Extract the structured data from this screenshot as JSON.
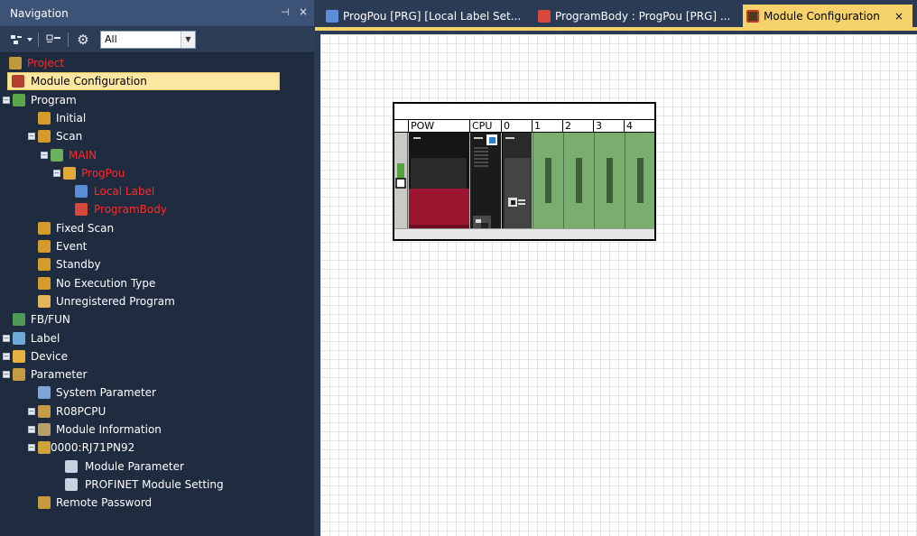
{
  "navigation": {
    "title": "Navigation",
    "pin_glyph": "⊣",
    "close_glyph": "×",
    "toolbar": {
      "filter_value": "All"
    },
    "tree": [
      {
        "label": "Project",
        "red": true
      },
      {
        "label": "Module Configuration",
        "selected": true
      },
      {
        "label": "Program"
      },
      {
        "label": "Initial"
      },
      {
        "label": "Scan"
      },
      {
        "label": "MAIN",
        "red": true
      },
      {
        "label": "ProgPou",
        "red": true
      },
      {
        "label": "Local Label",
        "red": true
      },
      {
        "label": "ProgramBody",
        "red": true
      },
      {
        "label": "Fixed Scan"
      },
      {
        "label": "Event"
      },
      {
        "label": "Standby"
      },
      {
        "label": "No Execution Type"
      },
      {
        "label": "Unregistered Program"
      },
      {
        "label": "FB/FUN"
      },
      {
        "label": "Label"
      },
      {
        "label": "Device"
      },
      {
        "label": "Parameter"
      },
      {
        "label": "System Parameter"
      },
      {
        "label": "R08PCPU"
      },
      {
        "label": "Module Information"
      },
      {
        "label": "0000:RJ71PN92"
      },
      {
        "label": "Module Parameter"
      },
      {
        "label": "PROFINET Module Setting"
      },
      {
        "label": "Remote Password"
      }
    ]
  },
  "tabs": [
    {
      "label": "ProgPou [PRG] [Local Label Set...",
      "icon": "local-label-icon"
    },
    {
      "label": "ProgramBody : ProgPou [PRG] ...",
      "icon": "program-body-icon"
    },
    {
      "label": "Module Configuration",
      "icon": "module-configuration-icon",
      "active": true,
      "close": "×"
    }
  ],
  "rack": {
    "slot_labels": [
      "POW",
      "CPU",
      "0",
      "1",
      "2",
      "3",
      "4"
    ]
  },
  "colors": {
    "selection": "#fbe7a1",
    "active_tab": "#f5d36a",
    "red_text": "#ff2a2a",
    "slot_green": "#7aae6f",
    "power_red": "#9b1530"
  }
}
